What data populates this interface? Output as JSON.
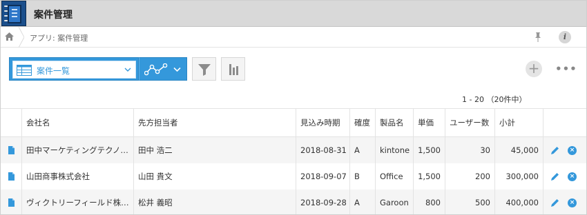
{
  "app": {
    "title": "案件管理"
  },
  "breadcrumb": {
    "text": "アプリ: 案件管理"
  },
  "toolbar": {
    "view_label": "案件一覧",
    "more_label": "•••",
    "add_label": "+"
  },
  "pager": {
    "text": "1 - 20 （20件中）"
  },
  "table": {
    "headers": [
      "会社名",
      "先方担当者",
      "見込み時期",
      "確度",
      "製品名",
      "単価",
      "ユーザー数",
      "小計"
    ],
    "rows": [
      [
        "田中マーケティングテクノ…",
        "田中 浩二",
        "2018-08-31",
        "A",
        "kintone",
        "1,500",
        "30",
        "45,000"
      ],
      [
        "山田商事株式会社",
        "山田 貴文",
        "2018-09-07",
        "B",
        "Office",
        "1,500",
        "200",
        "300,000"
      ],
      [
        "ヴィクトリーフィールド株…",
        "松井 義昭",
        "2018-09-28",
        "A",
        "Garoon",
        "800",
        "500",
        "400,000"
      ]
    ]
  },
  "colors": {
    "accent": "#3498db",
    "header_bg": "#d9d9d9",
    "row_alt": "#f5f5f5"
  },
  "icons": {
    "app": "notebook-icon",
    "home": "home-icon",
    "pin": "pin-icon",
    "info": "info-icon",
    "list": "list-view-icon",
    "graph": "graph-icon",
    "filter": "filter-icon",
    "chart": "bar-chart-icon",
    "doc": "document-icon",
    "edit": "pencil-icon",
    "delete": "close-circle-icon"
  }
}
